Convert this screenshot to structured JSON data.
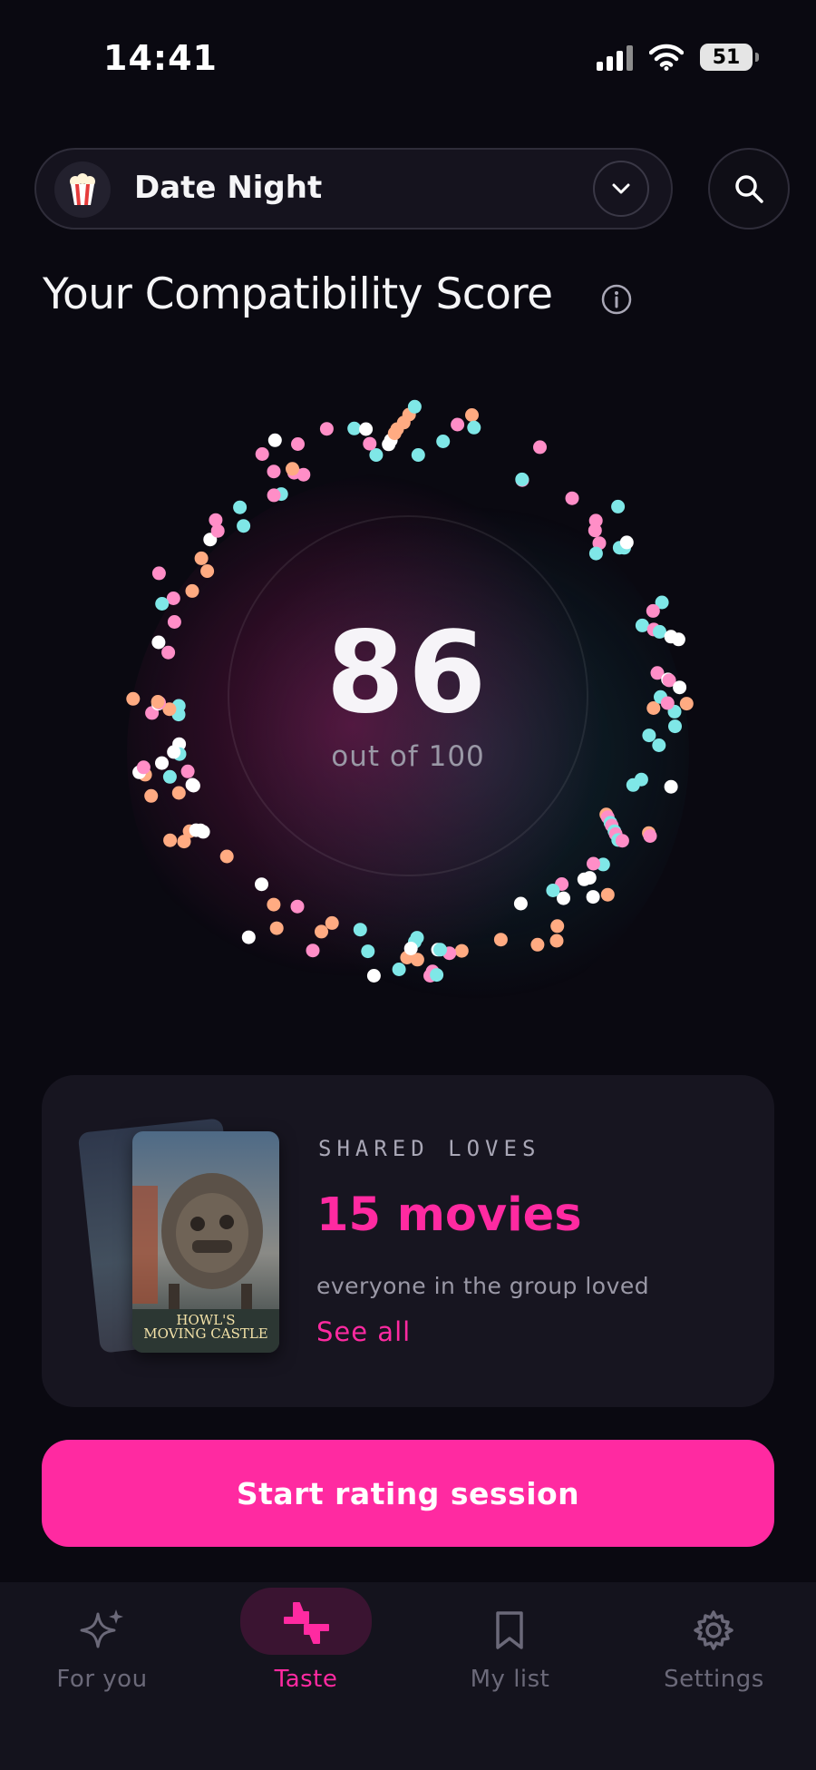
{
  "status_bar": {
    "time": "14:41",
    "battery": "51"
  },
  "group_selector": {
    "emoji": "🍿",
    "name": "Date Night"
  },
  "score_section": {
    "title": "Your Compatibility Score",
    "score": "86",
    "subtitle": "out of 100"
  },
  "shared_loves": {
    "eyebrow": "SHARED LOVES",
    "count": "15 movies",
    "description": "everyone in the group loved",
    "link": "See all",
    "poster_title_line1": "HOWL'S",
    "poster_title_line2": "MOVING CASTLE"
  },
  "cta_label": "Start rating session",
  "tabs": [
    {
      "label": "For you",
      "icon": "sparkles-icon"
    },
    {
      "label": "Taste",
      "icon": "thumbs-icon",
      "active": true
    },
    {
      "label": "My list",
      "icon": "bookmark-icon"
    },
    {
      "label": "Settings",
      "icon": "gear-icon"
    }
  ],
  "colors": {
    "accent": "#ff2aa1",
    "background": "#0a0911",
    "card": "#171520",
    "dot_pink": "#ff8ec7",
    "dot_cyan": "#7fe7e7",
    "dot_orange": "#ffab82",
    "dot_white": "#ffffff"
  }
}
